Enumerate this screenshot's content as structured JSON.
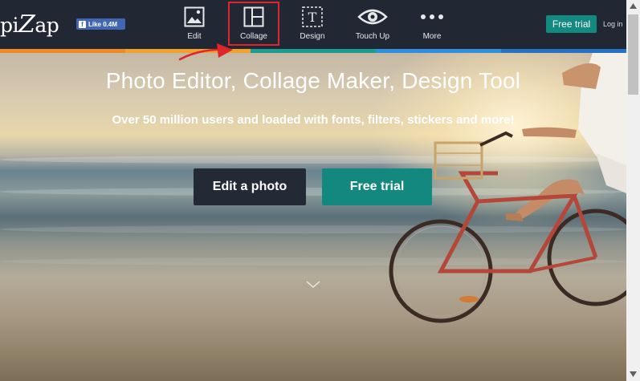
{
  "header": {
    "logo_pre": "pi",
    "logo_z": "Z",
    "logo_post": "ap",
    "fb_like": "Like 0.4M",
    "nav": [
      {
        "label": "Edit",
        "icon": "image-icon"
      },
      {
        "label": "Collage",
        "icon": "collage-grid-icon"
      },
      {
        "label": "Design",
        "icon": "text-frame-icon"
      },
      {
        "label": "Touch Up",
        "icon": "eye-icon"
      },
      {
        "label": "More",
        "icon": "more-dots-icon"
      }
    ],
    "free_trial": "Free trial",
    "login": "Log in"
  },
  "colorbar": [
    "#f08a24",
    "#f0a32c",
    "#1c9c8e",
    "#2f8fdc",
    "#2572c4"
  ],
  "hero": {
    "title": "Photo Editor, Collage Maker, Design Tool",
    "subtitle": "Over 50 million users and loaded with fonts, filters, stickers and more!",
    "edit_button": "Edit a photo",
    "trial_button": "Free trial"
  },
  "annotation": {
    "highlight_color": "#e0242b",
    "arrow_color": "#e0242b"
  }
}
